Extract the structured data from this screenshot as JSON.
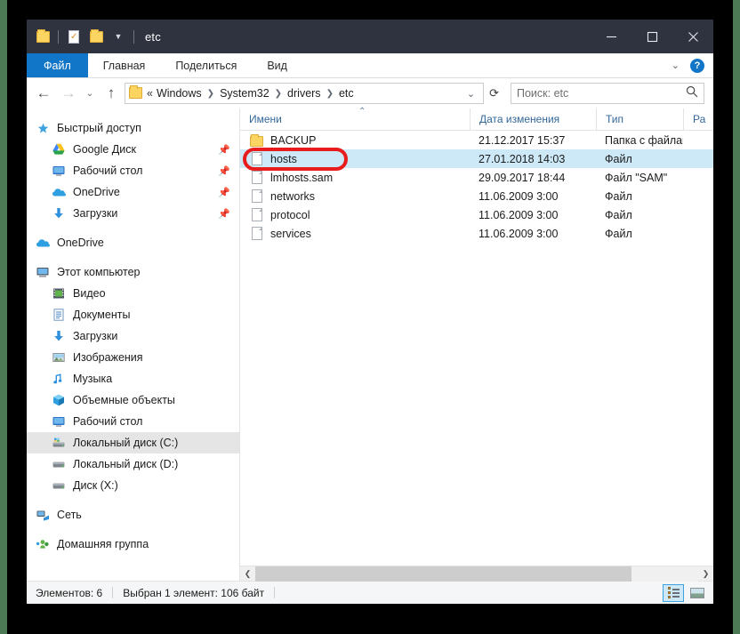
{
  "window": {
    "title": "etc",
    "controls": {
      "minimize": "minimize-icon",
      "maximize": "maximize-icon",
      "close": "close-icon"
    },
    "quick_access_icons": [
      "folder-icon",
      "properties-icon",
      "new-folder-icon",
      "chevron-down-icon"
    ]
  },
  "ribbon": {
    "tabs": [
      {
        "label": "Файл",
        "active": true
      },
      {
        "label": "Главная",
        "active": false
      },
      {
        "label": "Поделиться",
        "active": false
      },
      {
        "label": "Вид",
        "active": false
      }
    ],
    "collapse_icon": "chevron-down-icon",
    "help_label": "?"
  },
  "address_bar": {
    "back_icon": "back-arrow-icon",
    "forward_icon": "forward-arrow-icon",
    "recent_icon": "chevron-down-icon",
    "up_icon": "up-arrow-icon",
    "folder_icon": "folder-icon",
    "breadcrumb_prefix": "«",
    "breadcrumbs": [
      "Windows",
      "System32",
      "drivers",
      "etc"
    ],
    "dropdown_icon": "chevron-down-icon",
    "refresh_icon": "refresh-icon"
  },
  "search": {
    "placeholder": "Поиск: etc",
    "icon": "search-icon"
  },
  "nav_pane": {
    "sections": [
      {
        "header": {
          "label": "Быстрый доступ",
          "icon": "star-icon"
        },
        "items": [
          {
            "label": "Google Диск",
            "icon": "google-drive-icon",
            "pinned": true
          },
          {
            "label": "Рабочий стол",
            "icon": "desktop-icon",
            "pinned": true
          },
          {
            "label": "OneDrive",
            "icon": "onedrive-icon",
            "pinned": true
          },
          {
            "label": "Загрузки",
            "icon": "downloads-icon",
            "pinned": true
          }
        ]
      },
      {
        "header": {
          "label": "OneDrive",
          "icon": "onedrive-icon"
        },
        "items": []
      },
      {
        "header": {
          "label": "Этот компьютер",
          "icon": "computer-icon"
        },
        "items": [
          {
            "label": "Видео",
            "icon": "video-icon",
            "pinned": false
          },
          {
            "label": "Документы",
            "icon": "documents-icon",
            "pinned": false
          },
          {
            "label": "Загрузки",
            "icon": "downloads-icon",
            "pinned": false
          },
          {
            "label": "Изображения",
            "icon": "pictures-icon",
            "pinned": false
          },
          {
            "label": "Музыка",
            "icon": "music-icon",
            "pinned": false
          },
          {
            "label": "Объемные объекты",
            "icon": "3d-objects-icon",
            "pinned": false
          },
          {
            "label": "Рабочий стол",
            "icon": "desktop-icon",
            "pinned": false
          },
          {
            "label": "Локальный диск (C:)",
            "icon": "system-drive-icon",
            "pinned": false,
            "highlighted": true
          },
          {
            "label": "Локальный диск (D:)",
            "icon": "drive-icon",
            "pinned": false
          },
          {
            "label": "Диск (X:)",
            "icon": "drive-icon",
            "pinned": false
          }
        ]
      },
      {
        "header": {
          "label": "Сеть",
          "icon": "network-icon"
        },
        "items": []
      },
      {
        "header": {
          "label": "Домашняя группа",
          "icon": "homegroup-icon"
        },
        "items": []
      }
    ]
  },
  "file_list": {
    "columns": [
      {
        "label": "Имени",
        "sorted": true,
        "sort_icon": "caret-up-icon"
      },
      {
        "label": "Дата изменения",
        "sorted": false
      },
      {
        "label": "Тип",
        "sorted": false
      },
      {
        "label": "Ра",
        "sorted": false
      }
    ],
    "rows": [
      {
        "name": "BACKUP",
        "date": "21.12.2017 15:37",
        "type": "Папка с файлами",
        "icon": "folder-icon",
        "selected": false
      },
      {
        "name": "hosts",
        "date": "27.01.2018 14:03",
        "type": "Файл",
        "icon": "file-icon",
        "selected": true,
        "annotated": true
      },
      {
        "name": "lmhosts.sam",
        "date": "29.09.2017 18:44",
        "type": "Файл \"SAM\"",
        "icon": "file-icon",
        "selected": false
      },
      {
        "name": "networks",
        "date": "11.06.2009 3:00",
        "type": "Файл",
        "icon": "file-icon",
        "selected": false
      },
      {
        "name": "protocol",
        "date": "11.06.2009 3:00",
        "type": "Файл",
        "icon": "file-icon",
        "selected": false
      },
      {
        "name": "services",
        "date": "11.06.2009 3:00",
        "type": "Файл",
        "icon": "file-icon",
        "selected": false
      }
    ]
  },
  "scrollbar": {
    "left_icon": "chevron-left-icon",
    "right_icon": "chevron-right-icon"
  },
  "status_bar": {
    "item_count": "Элементов: 6",
    "selection": "Выбран 1 элемент: 106 байт",
    "view_buttons": [
      {
        "name": "details-view",
        "icon": "details-view-icon",
        "active": true
      },
      {
        "name": "thumbnails-view",
        "icon": "thumbnails-view-icon",
        "active": false
      }
    ]
  },
  "colors": {
    "titlebar": "#2f3340",
    "accent": "#1176c8",
    "selection": "#cde8f7",
    "annotation": "#e81c1c",
    "backdrop": "#000000",
    "edge": "#4c7a55"
  }
}
